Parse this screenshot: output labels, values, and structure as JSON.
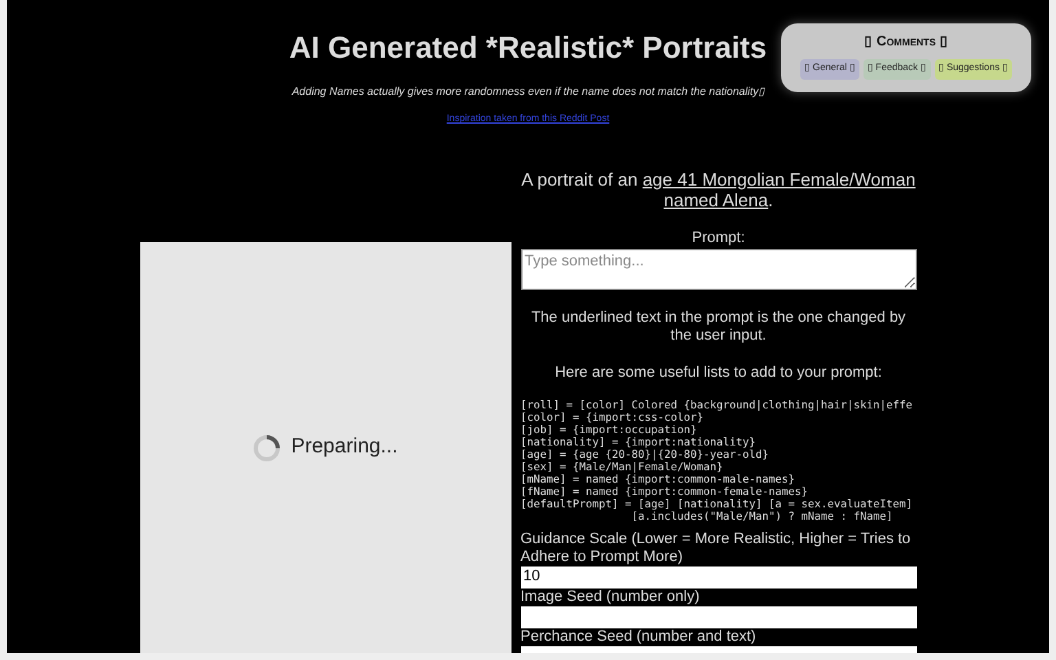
{
  "header": {
    "title": "AI Generated *Realistic* Portraits",
    "subtitle": "Adding Names actually gives more randomness even if the name does not match the nationality▯",
    "link": "Inspiration taken from this Reddit Post"
  },
  "comments": {
    "title": "▯ Comments ▯",
    "tabs": [
      {
        "label": "▯ General ▯",
        "color": "#b4b4cc"
      },
      {
        "label": "▯ Feedback ▯",
        "color": "#b8cab8"
      },
      {
        "label": "▯ Suggestions ▯",
        "color": "#c6d88c"
      }
    ]
  },
  "preview": {
    "status": "Preparing..."
  },
  "portrait": {
    "prefix": "A portrait of an ",
    "changed": "age 41 Mongolian Female/Woman named Alena",
    "suffix": "."
  },
  "prompt": {
    "label": "Prompt:",
    "placeholder": "Type something..."
  },
  "note": "The underlined text in the prompt is the one changed by the user input.",
  "lists_heading": "Here are some useful lists to add to your prompt:",
  "code_lines": [
    "[roll] = [color] Colored {background|clothing|hair|skin|effe",
    "[color] = {import:css-color}",
    "[job] = {import:occupation}",
    "[nationality] = {import:nationality}",
    "[age] = {age {20-80}|{20-80}-year-old}",
    "[sex] = {Male/Man|Female/Woman}",
    "[mName] = named {import:common-male-names}",
    "[fName] = named {import:common-female-names}",
    "[defaultPrompt] = [age] [nationality] [a = sex.evaluateItem]",
    "                 [a.includes(\"Male/Man\") ? mName : fName]"
  ],
  "fields": [
    {
      "label": "Guidance Scale (Lower = More Realistic, Higher = Tries to Adhere to Prompt More)",
      "value": "10"
    },
    {
      "label": "Image Seed (number only)"
    },
    {
      "label": "Perchance Seed (number and text)"
    }
  ]
}
